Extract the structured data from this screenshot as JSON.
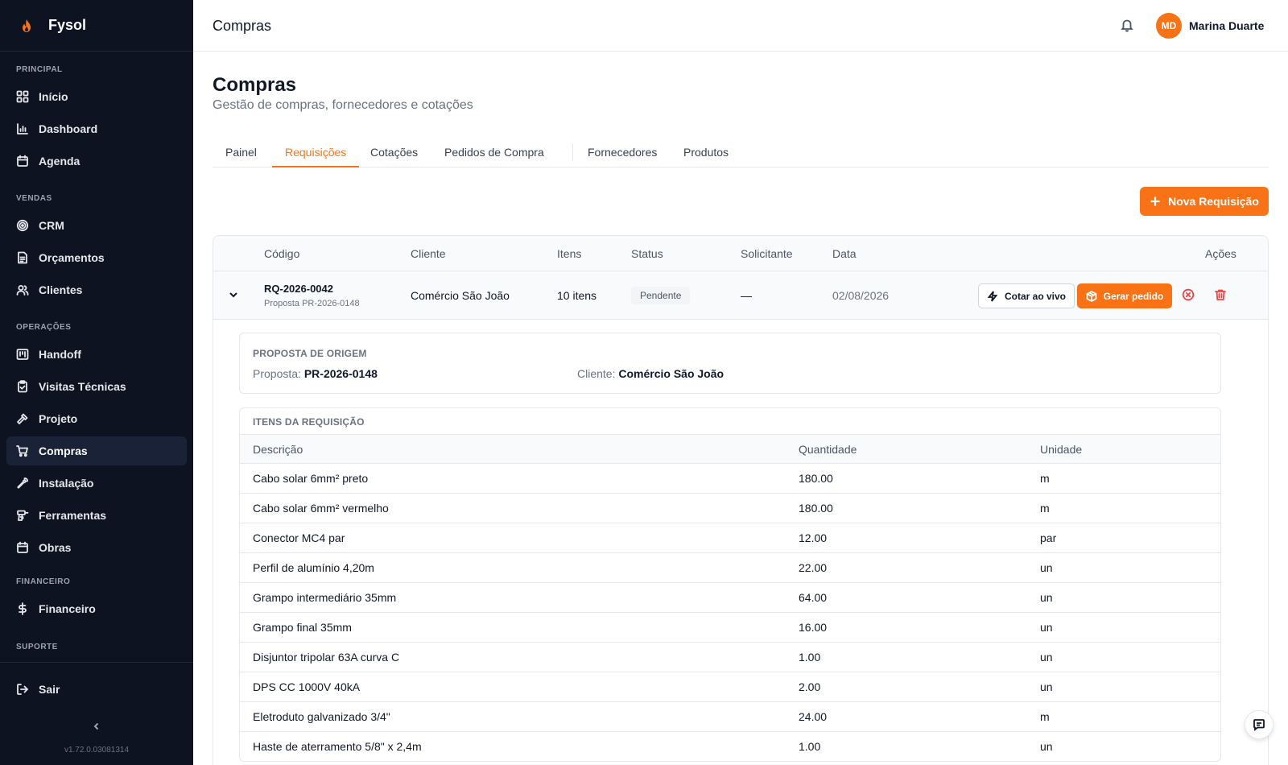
{
  "app": {
    "name": "Fysol",
    "version": "v1.72.0.03081314"
  },
  "sidebar": {
    "sections": [
      {
        "title": "PRINCIPAL",
        "items": [
          {
            "label": "Início",
            "icon": "home-grid-icon"
          },
          {
            "label": "Dashboard",
            "icon": "bar-chart-icon"
          },
          {
            "label": "Agenda",
            "icon": "calendar-icon"
          }
        ]
      },
      {
        "title": "VENDAS",
        "items": [
          {
            "label": "CRM",
            "icon": "target-icon"
          },
          {
            "label": "Orçamentos",
            "icon": "document-icon"
          },
          {
            "label": "Clientes",
            "icon": "users-icon"
          }
        ]
      },
      {
        "title": "OPERAÇÕES",
        "items": [
          {
            "label": "Handoff",
            "icon": "kanban-icon"
          },
          {
            "label": "Visitas Técnicas",
            "icon": "clipboard-check-icon"
          },
          {
            "label": "Projeto",
            "icon": "hammer-icon"
          },
          {
            "label": "Compras",
            "icon": "cart-icon",
            "active": true
          },
          {
            "label": "Instalação",
            "icon": "wrench-icon"
          },
          {
            "label": "Ferramentas",
            "icon": "drill-icon"
          },
          {
            "label": "Obras",
            "icon": "calendar-icon"
          }
        ]
      },
      {
        "title": "FINANCEIRO",
        "items": [
          {
            "label": "Financeiro",
            "icon": "dollar-icon"
          }
        ]
      },
      {
        "title": "SUPORTE",
        "items": []
      }
    ],
    "logout": {
      "label": "Sair",
      "icon": "logout-icon"
    },
    "collapse_icon": "chevron-left-icon"
  },
  "topbar": {
    "title": "Compras",
    "notification_icon": "bell-icon",
    "user": {
      "initials": "MD",
      "name": "Marina Duarte"
    }
  },
  "page": {
    "title": "Compras",
    "subtitle": "Gestão de compras, fornecedores e cotações",
    "tabs": [
      {
        "label": "Painel",
        "active": false
      },
      {
        "label": "Requisições",
        "active": true
      },
      {
        "label": "Cotações",
        "active": false
      },
      {
        "label": "Pedidos de Compra",
        "active": false
      },
      {
        "label": "Fornecedores",
        "active": false
      },
      {
        "label": "Produtos",
        "active": false
      }
    ],
    "new_button": "Nova Requisição"
  },
  "table": {
    "columns": [
      "Código",
      "Cliente",
      "Itens",
      "Status",
      "Solicitante",
      "Data",
      "Ações"
    ],
    "rows": [
      {
        "code": "RQ-2026-0042",
        "proposal": "Proposta PR-2026-0148",
        "client": "Comércio São João",
        "items": "10 itens",
        "status": "Pendente",
        "requester": "—",
        "date": "02/08/2026",
        "actions": {
          "quote_live": "Cotar ao vivo",
          "generate_order": "Gerar pedido"
        }
      }
    ]
  },
  "details": {
    "origin": {
      "label": "PROPOSTA DE ORIGEM",
      "proposal_key": "Proposta:",
      "proposal_value": "PR-2026-0148",
      "client_key": "Cliente:",
      "client_value": "Comércio São João"
    },
    "items": {
      "label": "ITENS DA REQUISIÇÃO",
      "columns": [
        "Descrição",
        "Quantidade",
        "Unidade"
      ],
      "rows": [
        {
          "desc": "Cabo solar 6mm² preto",
          "qty": "180.00",
          "unit": "m"
        },
        {
          "desc": "Cabo solar 6mm² vermelho",
          "qty": "180.00",
          "unit": "m"
        },
        {
          "desc": "Conector MC4 par",
          "qty": "12.00",
          "unit": "par"
        },
        {
          "desc": "Perfil de alumínio 4,20m",
          "qty": "22.00",
          "unit": "un"
        },
        {
          "desc": "Grampo intermediário 35mm",
          "qty": "64.00",
          "unit": "un"
        },
        {
          "desc": "Grampo final 35mm",
          "qty": "16.00",
          "unit": "un"
        },
        {
          "desc": "Disjuntor tripolar 63A curva C",
          "qty": "1.00",
          "unit": "un"
        },
        {
          "desc": "DPS CC 1000V 40kA",
          "qty": "2.00",
          "unit": "un"
        },
        {
          "desc": "Eletroduto galvanizado 3/4\"",
          "qty": "24.00",
          "unit": "m"
        },
        {
          "desc": "Haste de aterramento 5/8\" x 2,4m",
          "qty": "1.00",
          "unit": "un"
        }
      ]
    }
  },
  "colors": {
    "accent": "#f97316",
    "sidebar_bg": "#0d1321",
    "danger": "#ef4444"
  }
}
